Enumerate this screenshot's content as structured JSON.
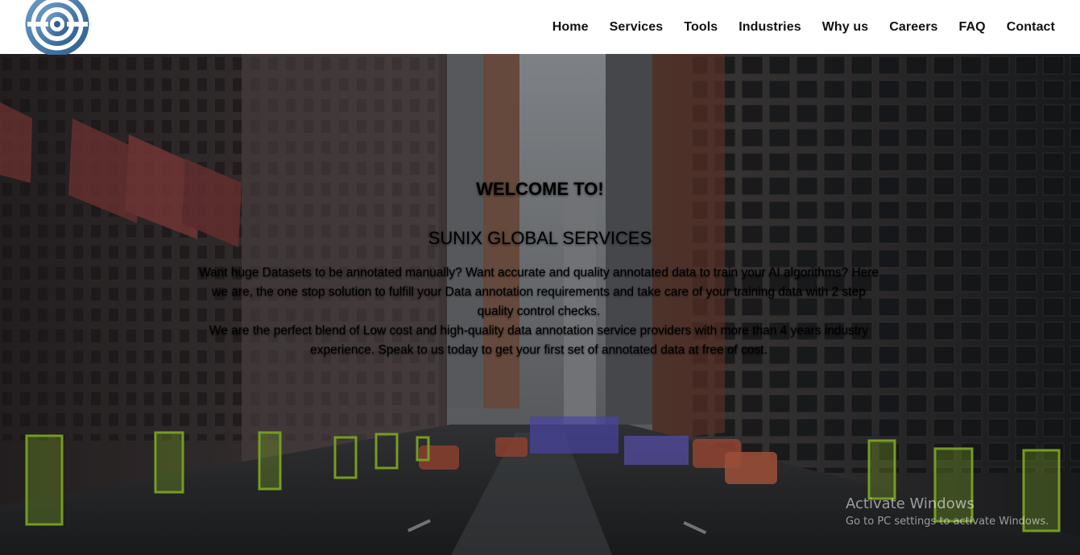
{
  "brand": {
    "logo_icon": "concentric-target-logo",
    "primary_color": "#4b7ba8"
  },
  "nav": {
    "items": [
      {
        "label": "Home"
      },
      {
        "label": "Services"
      },
      {
        "label": "Tools"
      },
      {
        "label": "Industries"
      },
      {
        "label": "Why us"
      },
      {
        "label": "Careers"
      },
      {
        "label": "FAQ"
      },
      {
        "label": "Contact"
      }
    ]
  },
  "hero": {
    "welcome": "WELCOME TO!",
    "company": "SUNIX GLOBAL SERVICES",
    "paragraph1": "Want huge Datasets to be annotated manually? Want accurate and quality annotated data to train your AI algorithms? Here we are, the one stop solution to fulfill your Data annotation requirements and take care of your training data with 2 step quality control checks.",
    "paragraph2": "We are the perfect blend of Low cost and high-quality data annotation service providers with more than 4 years industry experience. Speak to us today to get your first set of annotated data at free of cost.",
    "background": "city-street-annotated-photo"
  },
  "watermark": {
    "title": "Activate Windows",
    "subtitle": "Go to PC settings to activate Windows."
  }
}
